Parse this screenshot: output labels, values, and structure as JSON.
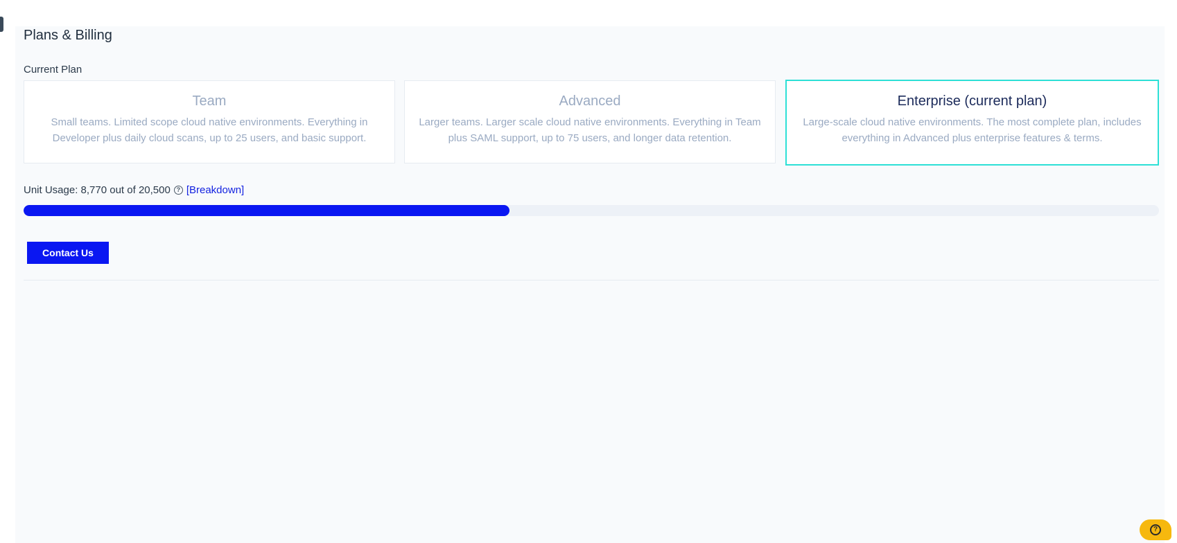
{
  "page": {
    "title": "Plans & Billing"
  },
  "current_plan": {
    "label": "Current Plan",
    "plans": [
      {
        "name": "Team",
        "description": "Small teams. Limited scope cloud native environments. Everything in Developer plus daily cloud scans, up to 25 users, and basic support."
      },
      {
        "name": "Advanced",
        "description": "Larger teams. Larger scale cloud native environments. Everything in Team plus SAML support, up to 75 users, and longer data retention."
      },
      {
        "name": "Enterprise (current plan)",
        "description": "Large-scale cloud native environments. The most complete plan, includes everything in Advanced plus enterprise features & terms."
      }
    ]
  },
  "usage": {
    "text": "Unit Usage: 8,770 out of 20,500",
    "used": 8770,
    "total": 20500,
    "breakdown_label": "[Breakdown]",
    "help_icon": "question-circle-icon"
  },
  "actions": {
    "contact_label": "Contact Us"
  },
  "help_widget": {
    "icon": "question-circle-icon"
  },
  "colors": {
    "accent": "#0a17f2",
    "current_plan_border": "#2de0d6",
    "help_widget": "#f6b80e"
  }
}
